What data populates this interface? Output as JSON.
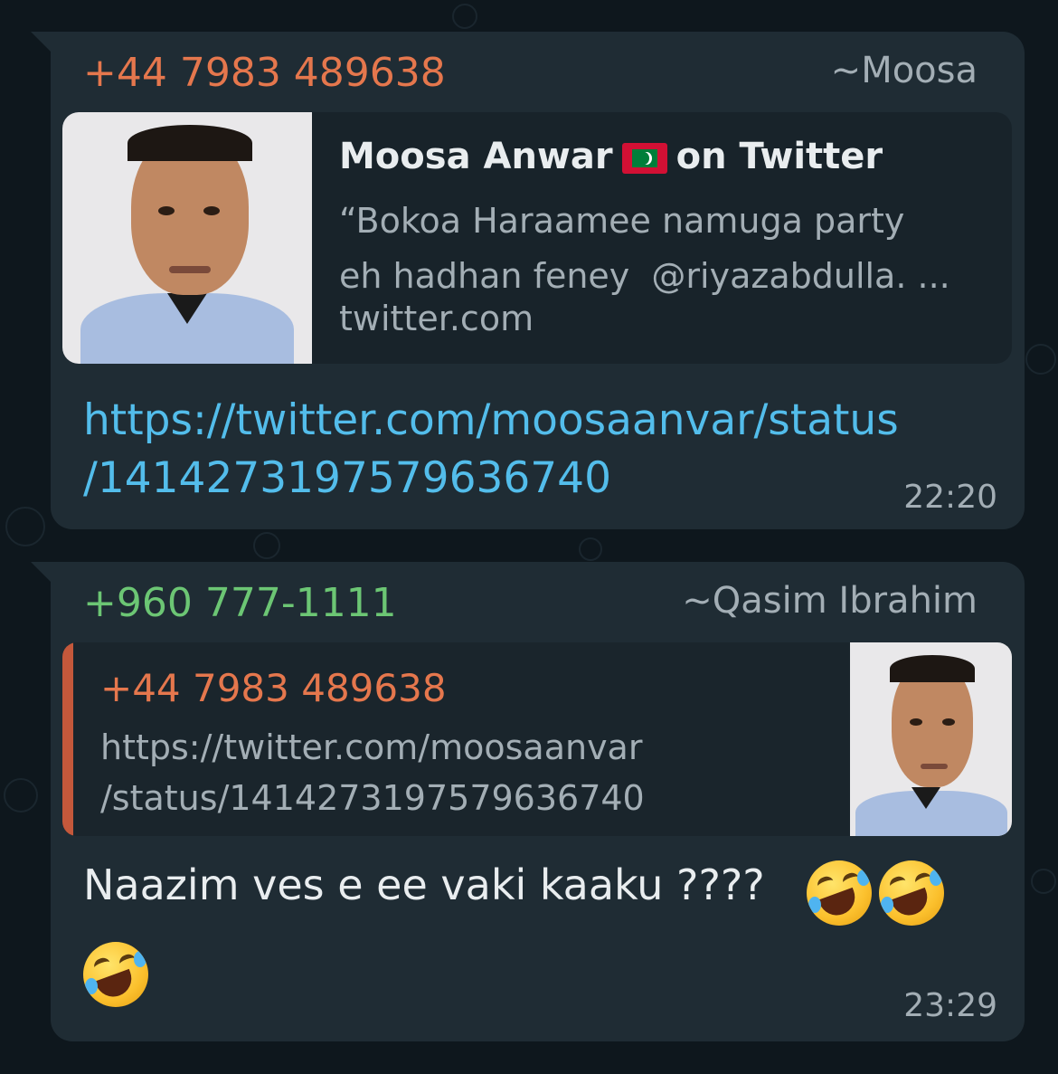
{
  "messages": [
    {
      "sender_phone": "+44 7983 489638",
      "sender_phone_color": "#e5774d",
      "sender_name": "~Moosa",
      "link_preview": {
        "title_before": "Moosa Anwar",
        "flag_icon": "maldives-flag-icon",
        "title_after": "on Twitter",
        "description": "“Bokoa Haraamee namuga party\neh hadhan feney  @riyazabdulla. ...",
        "domain": "twitter.com"
      },
      "link_text": "https://twitter.com/moosaanvar/status\n/1414273197579636740",
      "time": "22:20"
    },
    {
      "sender_phone": "+960 777-1111",
      "sender_phone_color": "#6cc674",
      "sender_name": "~Qasim Ibrahim",
      "quoted": {
        "phone": "+44 7983 489638",
        "text": "https://twitter.com/moosaanvar\n/status/1414273197579636740"
      },
      "text": "Naazim ves e ee vaki kaaku ????",
      "emoji": [
        "rolling-on-floor-laughing-emoji",
        "rolling-on-floor-laughing-emoji",
        "rolling-on-floor-laughing-emoji"
      ],
      "time": "23:29"
    }
  ],
  "colors": {
    "bubble": "#1f2c34",
    "link": "#53bdeb",
    "quote_bar": "#c4583b"
  }
}
